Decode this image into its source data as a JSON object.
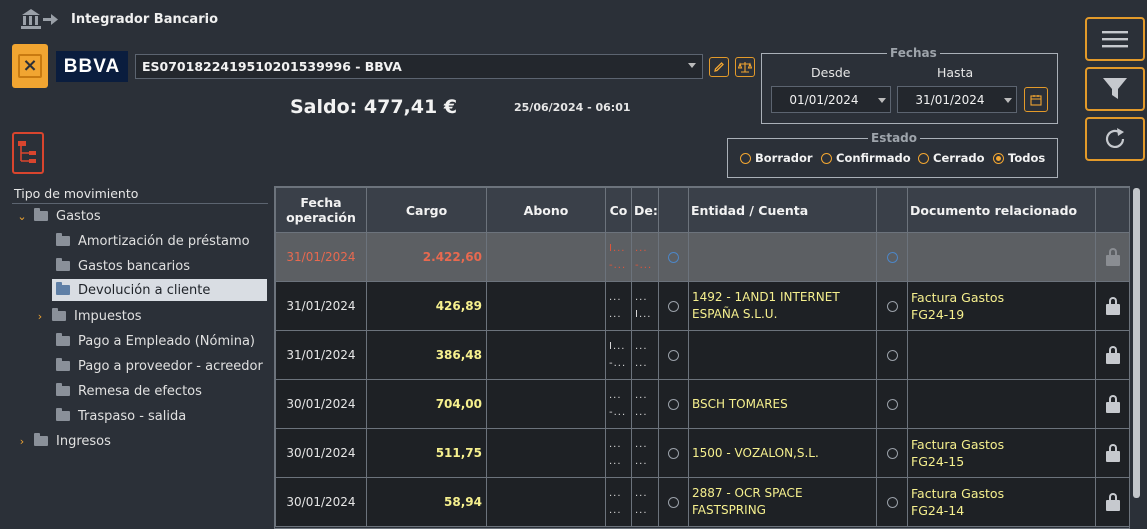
{
  "app": {
    "title": "Integrador Bancario",
    "bank_logo_text": "BBVA"
  },
  "account": {
    "selected": "ES0701822419510201539996 - BBVA"
  },
  "balance": {
    "text": "Saldo: 477,41 €",
    "timestamp": "25/06/2024 - 06:01"
  },
  "fechas": {
    "legend": "Fechas",
    "desde_label": "Desde",
    "hasta_label": "Hasta",
    "desde_value": "01/01/2024",
    "hasta_value": "31/01/2024"
  },
  "estado": {
    "legend": "Estado",
    "options": [
      "Borrador",
      "Confirmado",
      "Cerrado",
      "Todos"
    ],
    "selected": "Todos"
  },
  "tree": {
    "header": "Tipo de movimiento",
    "items": [
      {
        "label": "Gastos",
        "level": 0,
        "expanded": true
      },
      {
        "label": "Amortización de préstamo",
        "level": 1
      },
      {
        "label": "Gastos bancarios",
        "level": 1
      },
      {
        "label": "Devolución a cliente",
        "level": 1,
        "selected": true
      },
      {
        "label": "Impuestos",
        "level": 1,
        "collapsed": true
      },
      {
        "label": "Pago a Empleado (Nómina)",
        "level": 1
      },
      {
        "label": "Pago a proveedor - acreedor",
        "level": 1
      },
      {
        "label": "Remesa de efectos",
        "level": 1
      },
      {
        "label": "Traspaso - salida",
        "level": 1
      },
      {
        "label": "Ingresos",
        "level": 0,
        "collapsed": true
      }
    ]
  },
  "table": {
    "headers": [
      "Fecha operación",
      "Cargo",
      "Abono",
      "Co",
      "De:",
      "",
      "Entidad / Cuenta",
      "",
      "Documento relacionado",
      ""
    ],
    "rows": [
      {
        "fecha": "31/01/2024",
        "cargo": "2.422,60",
        "abono": "",
        "co": [
          "I...",
          "-..."
        ],
        "de": [
          "...",
          "-..."
        ],
        "entidad": [
          "",
          ""
        ],
        "doc": [
          "",
          ""
        ],
        "selected": true
      },
      {
        "fecha": "31/01/2024",
        "cargo": "426,89",
        "abono": "",
        "co": [
          "...",
          "..."
        ],
        "de": [
          "...",
          "I..."
        ],
        "entidad": [
          "1492 - 1AND1 INTERNET",
          "ESPAÑA S.L.U."
        ],
        "doc": [
          "Factura Gastos",
          "FG24-19"
        ]
      },
      {
        "fecha": "31/01/2024",
        "cargo": "386,48",
        "abono": "",
        "co": [
          "I...",
          "-..."
        ],
        "de": [
          "...",
          "..."
        ],
        "entidad": [
          "",
          ""
        ],
        "doc": [
          "",
          ""
        ]
      },
      {
        "fecha": "30/01/2024",
        "cargo": "704,00",
        "abono": "",
        "co": [
          "...",
          "-..."
        ],
        "de": [
          "...",
          "..."
        ],
        "entidad": [
          "BSCH TOMARES",
          ""
        ],
        "doc": [
          "",
          ""
        ]
      },
      {
        "fecha": "30/01/2024",
        "cargo": "511,75",
        "abono": "",
        "co": [
          "...",
          "..."
        ],
        "de": [
          "...",
          "..."
        ],
        "entidad": [
          "1500 - VOZALON,S.L.",
          ""
        ],
        "doc": [
          "Factura Gastos",
          "FG24-15"
        ]
      },
      {
        "fecha": "30/01/2024",
        "cargo": "58,94",
        "abono": "",
        "co": [
          "...",
          "..."
        ],
        "de": [
          "...",
          "..."
        ],
        "entidad": [
          "2887 - OCR SPACE",
          "FASTSPRING"
        ],
        "doc": [
          "Factura Gastos",
          "FG24-14"
        ]
      }
    ]
  },
  "colors": {
    "accent": "#f1a531",
    "amount": "#f6f08e",
    "negative": "#e8694f"
  }
}
